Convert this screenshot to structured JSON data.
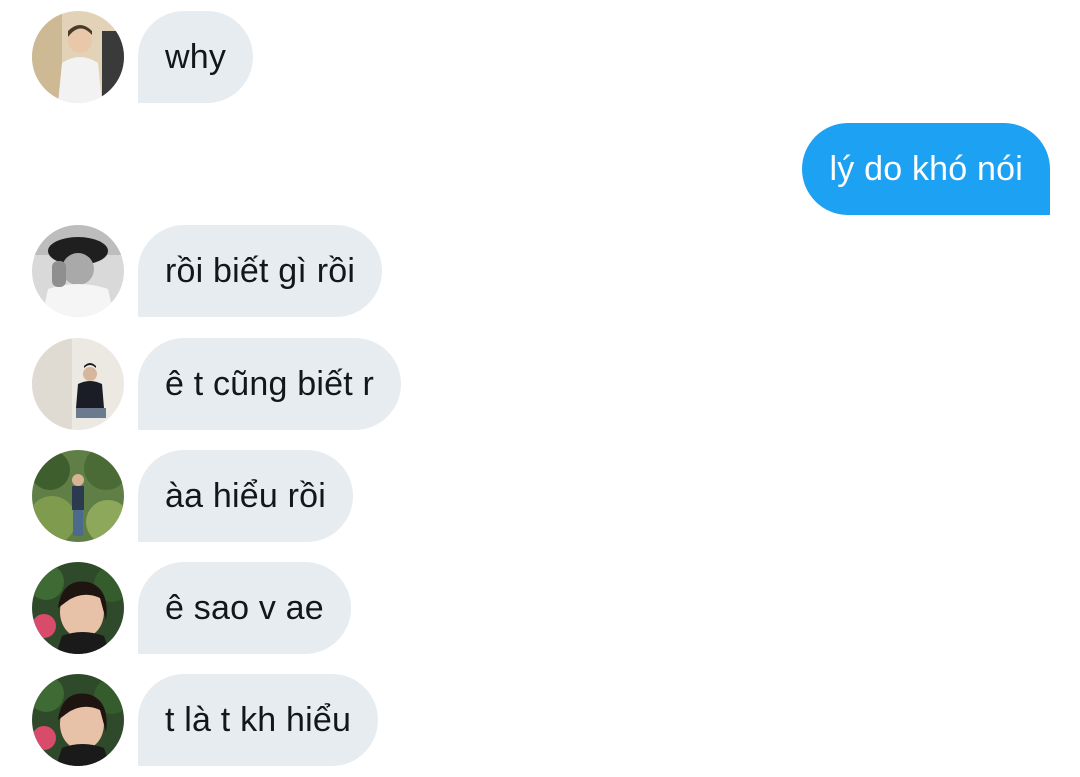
{
  "messages": [
    {
      "direction": "in",
      "text": "why",
      "avatar": "avatar-user-1"
    },
    {
      "direction": "out",
      "text": "lý do khó nói"
    },
    {
      "direction": "in",
      "text": "rồi biết gì rồi",
      "avatar": "avatar-user-2"
    },
    {
      "direction": "in",
      "text": "ê t cũng biết r",
      "avatar": "avatar-user-3"
    },
    {
      "direction": "in",
      "text": "àa hiểu rồi",
      "avatar": "avatar-user-4"
    },
    {
      "direction": "in",
      "text": "ê sao v ae",
      "avatar": "avatar-user-5"
    },
    {
      "direction": "in",
      "text": "t là t kh hiểu",
      "avatar": "avatar-user-5"
    }
  ],
  "colors": {
    "incoming_bubble": "#e6ecf0",
    "outgoing_bubble": "#1da1f2",
    "incoming_text": "#14171a",
    "outgoing_text": "#ffffff"
  }
}
